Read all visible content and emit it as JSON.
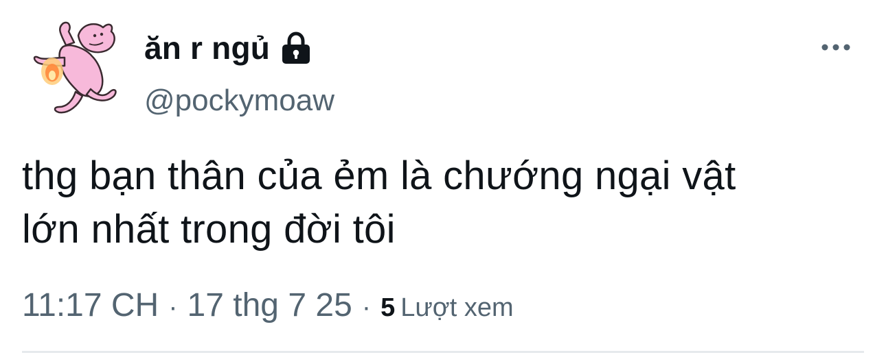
{
  "tweet": {
    "display_name": "ăn r ngủ",
    "handle": "@pockymoaw",
    "text_line_1": "thg bạn thân của ẻm là chướng ngại vật",
    "text_line_2": "lớn nhất trong đời tôi",
    "time": "11:17 CH",
    "separator_1": "·",
    "date": "17 thg 7 25",
    "separator_2": "·",
    "view_count": "5",
    "view_label": "Lượt xem"
  },
  "icons": {
    "lock": "lock-icon",
    "more": "more-horizontal-icon",
    "avatar": "pink-cartoon-avatar"
  },
  "colors": {
    "text_primary": "#0f1419",
    "text_secondary": "#536471",
    "avatar_pink": "#f5b6d9",
    "divider": "#e6e9ec"
  }
}
